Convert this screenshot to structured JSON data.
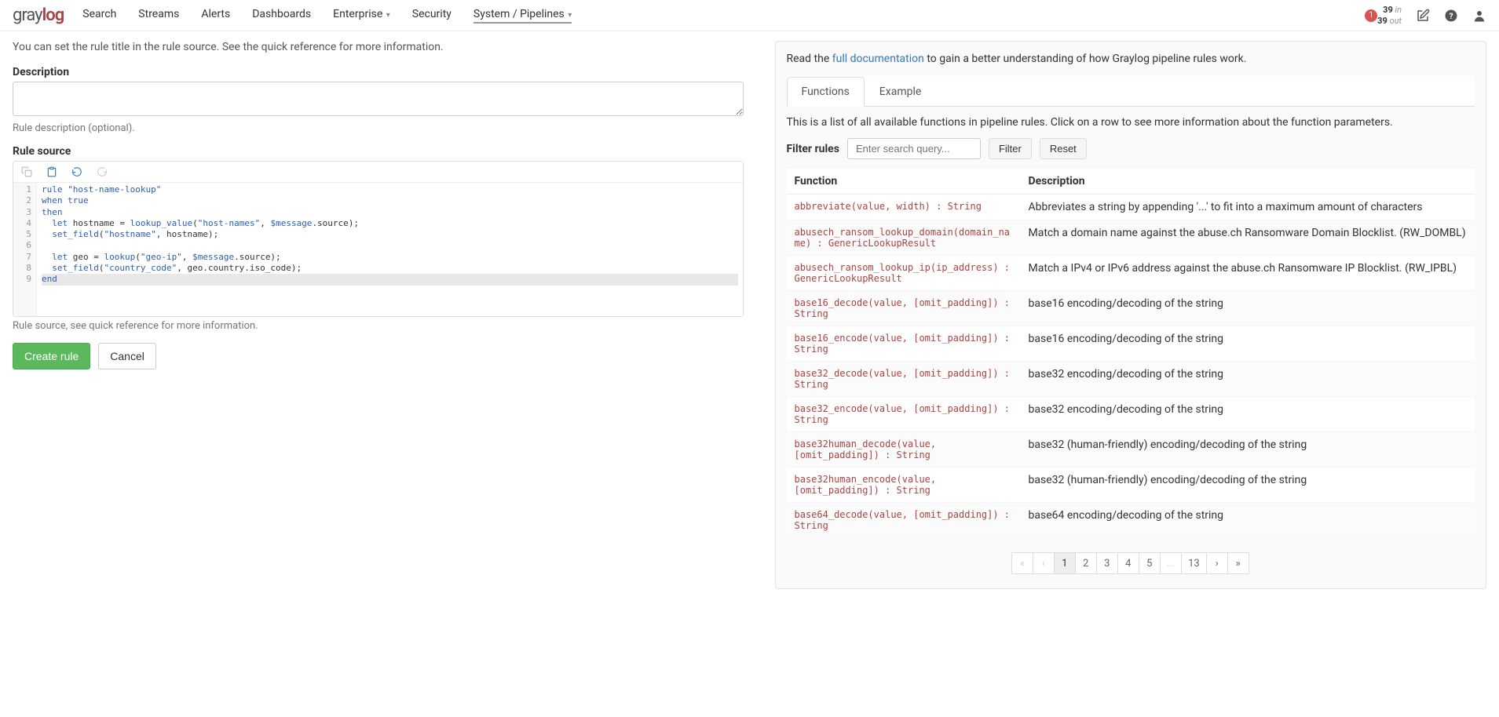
{
  "nav": {
    "logo_gray": "gray",
    "logo_log": "log",
    "items": [
      {
        "label": "Search"
      },
      {
        "label": "Streams"
      },
      {
        "label": "Alerts"
      },
      {
        "label": "Dashboards"
      },
      {
        "label": "Enterprise",
        "caret": true
      },
      {
        "label": "Security"
      },
      {
        "label": "System / Pipelines",
        "caret": true,
        "active": true
      }
    ],
    "badge": "1",
    "throughput_in_count": "39",
    "throughput_in_label": "in",
    "throughput_out_count": "39",
    "throughput_out_label": "out"
  },
  "left": {
    "title_hint": "You can set the rule title in the rule source. See the quick reference for more information.",
    "desc_label": "Description",
    "desc_helper": "Rule description (optional).",
    "source_label": "Rule source",
    "source_helper": "Rule source, see quick reference for more information.",
    "code": {
      "lines": [
        {
          "n": "1",
          "raw": "rule \"host-name-lookup\""
        },
        {
          "n": "2",
          "raw": "when true"
        },
        {
          "n": "3",
          "raw": "then"
        },
        {
          "n": "4",
          "raw": "  let hostname = lookup_value(\"host-names\", $message.source);"
        },
        {
          "n": "5",
          "raw": "  set_field(\"hostname\", hostname);"
        },
        {
          "n": "6",
          "raw": ""
        },
        {
          "n": "7",
          "raw": "  let geo = lookup(\"geo-ip\", $message.source);"
        },
        {
          "n": "8",
          "raw": "  set_field(\"country_code\", geo.country.iso_code);"
        },
        {
          "n": "9",
          "raw": "end",
          "hl": true
        }
      ]
    },
    "create_label": "Create rule",
    "cancel_label": "Cancel"
  },
  "right": {
    "doc_prefix": "Read the ",
    "doc_link": "full documentation",
    "doc_suffix": " to gain a better understanding of how Graylog pipeline rules work.",
    "tabs": {
      "functions": "Functions",
      "example": "Example"
    },
    "intro": "This is a list of all available functions in pipeline rules. Click on a row to see more information about the function parameters.",
    "filter": {
      "label": "Filter rules",
      "placeholder": "Enter search query...",
      "filter_btn": "Filter",
      "reset_btn": "Reset"
    },
    "table": {
      "head_function": "Function",
      "head_desc": "Description",
      "rows": [
        {
          "sig": "abbreviate(value, width) : String",
          "desc": "Abbreviates a string by appending '...' to fit into a maximum amount of characters"
        },
        {
          "sig": "abusech_ransom_lookup_domain(domain_name) : GenericLookupResult",
          "desc": "Match a domain name against the abuse.ch Ransomware Domain Blocklist. (RW_DOMBL)"
        },
        {
          "sig": "abusech_ransom_lookup_ip(ip_address) : GenericLookupResult",
          "desc": "Match a IPv4 or IPv6 address against the abuse.ch Ransomware IP Blocklist. (RW_IPBL)"
        },
        {
          "sig": "base16_decode(value, [omit_padding]) : String",
          "desc": "base16 encoding/decoding of the string"
        },
        {
          "sig": "base16_encode(value, [omit_padding]) : String",
          "desc": "base16 encoding/decoding of the string"
        },
        {
          "sig": "base32_decode(value, [omit_padding]) : String",
          "desc": "base32 encoding/decoding of the string"
        },
        {
          "sig": "base32_encode(value, [omit_padding]) : String",
          "desc": "base32 encoding/decoding of the string"
        },
        {
          "sig": "base32human_decode(value, [omit_padding]) : String",
          "desc": "base32 (human-friendly) encoding/decoding of the string"
        },
        {
          "sig": "base32human_encode(value, [omit_padding]) : String",
          "desc": "base32 (human-friendly) encoding/decoding of the string"
        },
        {
          "sig": "base64_decode(value, [omit_padding]) : String",
          "desc": "base64 encoding/decoding of the string"
        }
      ]
    },
    "pagination": [
      "1",
      "2",
      "3",
      "4",
      "5",
      "...",
      "13"
    ]
  }
}
